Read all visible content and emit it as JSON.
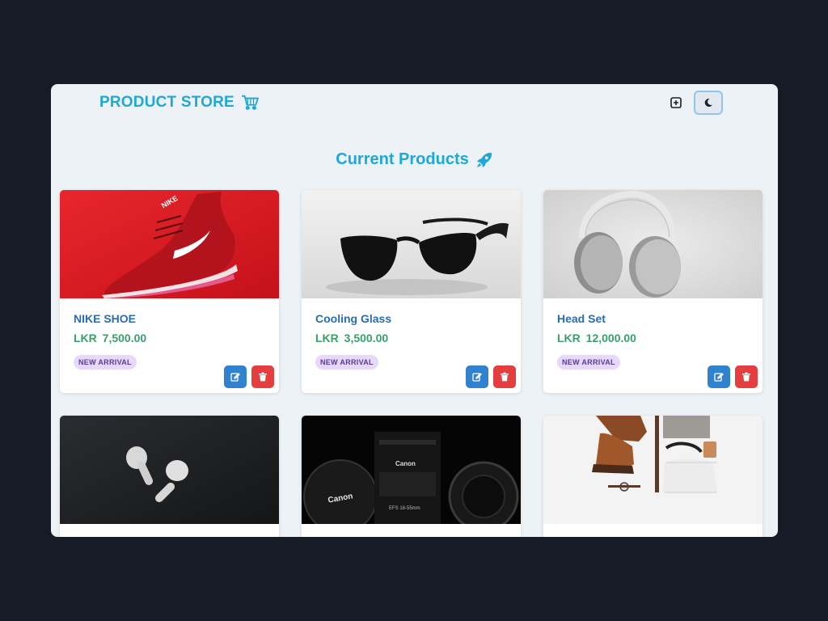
{
  "brand": {
    "title": "PRODUCT STORE",
    "icon": "shopping-cart-icon"
  },
  "navbar": {
    "add_icon": "plus-square-icon",
    "theme_icon": "moon-icon"
  },
  "page": {
    "heading": "Current Products",
    "heading_icon": "rocket-icon"
  },
  "colors": {
    "accent": "#1ea7d9",
    "name": "#2b6cb0",
    "price": "#38a169",
    "edit": "#3182ce",
    "delete": "#e53e3e",
    "badge_bg": "#e9d8fd",
    "badge_fg": "#553c9a"
  },
  "products": [
    {
      "name": "NIKE SHOE",
      "currency": "LKR",
      "price": "7,500.00",
      "badge": "NEW ARRIVAL"
    },
    {
      "name": "Cooling Glass",
      "currency": "LKR",
      "price": "3,500.00",
      "badge": "NEW ARRIVAL"
    },
    {
      "name": "Head Set",
      "currency": "LKR",
      "price": "12,000.00",
      "badge": "NEW ARRIVAL"
    },
    {
      "name": "",
      "currency": "",
      "price": "",
      "badge": ""
    },
    {
      "name": "",
      "currency": "",
      "price": "",
      "badge": ""
    },
    {
      "name": "",
      "currency": "",
      "price": "",
      "badge": ""
    }
  ],
  "image_labels": {
    "camera_brand": "Canon",
    "lens_text": "EFS 18-55mm",
    "shoe_brand": "NIKE"
  }
}
